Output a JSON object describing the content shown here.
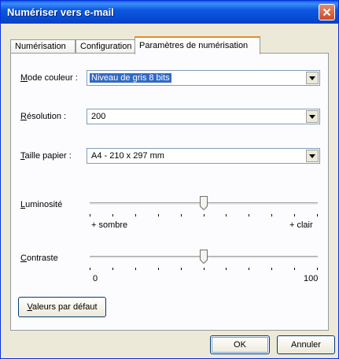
{
  "window": {
    "title": "Numériser vers e-mail"
  },
  "tabs": [
    {
      "label": "Numérisation",
      "active": false
    },
    {
      "label": "Configuration",
      "active": false
    },
    {
      "label": "Paramètres de numérisation",
      "active": true
    }
  ],
  "fields": {
    "mode_couleur": {
      "label": "Mode couleur :",
      "value": "Niveau de gris 8 bits"
    },
    "resolution": {
      "label": "Résolution :",
      "value": "200"
    },
    "taille_papier": {
      "label": "Taille papier :",
      "value": "A4 - 210 x 297 mm"
    }
  },
  "sliders": {
    "luminosite": {
      "label": "Luminosité",
      "min_label": "+ sombre",
      "max_label": "+ clair",
      "position": 0.5,
      "ticks": 11
    },
    "contraste": {
      "label": "Contraste",
      "min_label": "0",
      "max_label": "100",
      "position": 0.5,
      "ticks": 11
    }
  },
  "buttons": {
    "defaults": "Valeurs par défaut",
    "ok": "OK",
    "cancel": "Annuler"
  },
  "colors": {
    "titlebar": "#0b59e0",
    "close": "#cf4a22",
    "active_tab_accent": "#e68b2c",
    "selection": "#316ac5"
  },
  "icons": {
    "close": "close-icon",
    "dropdown": "chevron-down-icon"
  }
}
